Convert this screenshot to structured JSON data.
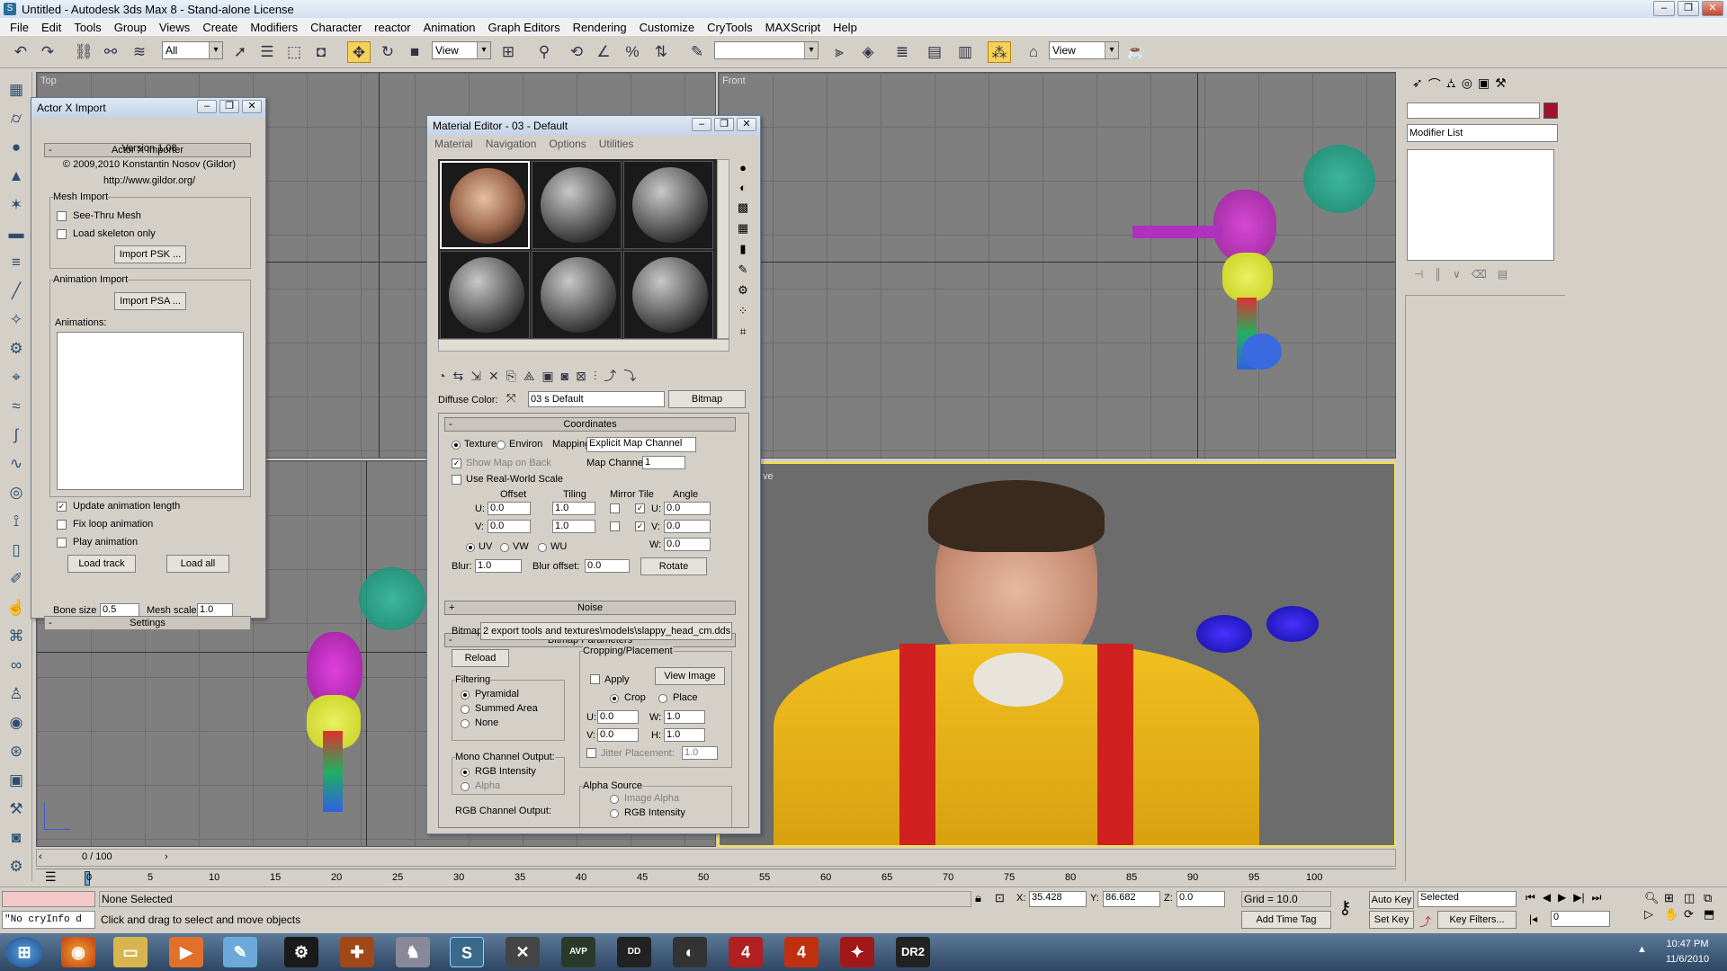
{
  "window": {
    "title": "Untitled - Autodesk 3ds Max 8 - Stand-alone License",
    "icon": "S"
  },
  "menu": [
    "File",
    "Edit",
    "Tools",
    "Group",
    "Views",
    "Create",
    "Modifiers",
    "Character",
    "reactor",
    "Animation",
    "Graph Editors",
    "Rendering",
    "Customize",
    "CryTools",
    "MAXScript",
    "Help"
  ],
  "toolbar": {
    "selection_filter": "All",
    "ref_coord": "View",
    "named_sel": "",
    "render_view": "View"
  },
  "viewports": {
    "top": "Top",
    "front": "Front",
    "persp_fragment": "ve"
  },
  "actorx": {
    "title": "Actor X Import",
    "rollout": "Actor X Importer",
    "version": "Version 1.08",
    "copyright": "© 2009,2010 Konstantin Nosov (Gildor)",
    "url": "http://www.gildor.org/",
    "mesh_import": "Mesh Import",
    "see_thru": "See-Thru Mesh",
    "load_skeleton": "Load skeleton only",
    "import_psk": "Import PSK ...",
    "anim_import": "Animation Import",
    "import_psa": "Import PSA ...",
    "animations": "Animations:",
    "update_len": "Update animation length",
    "fix_loop": "Fix loop animation",
    "play_anim": "Play animation",
    "load_track": "Load track",
    "load_all": "Load all",
    "settings": "Settings",
    "bone_size": "Bone size",
    "bone_size_val": "0.5",
    "mesh_scale": "Mesh scale",
    "mesh_scale_val": "1.0"
  },
  "mated": {
    "title": "Material Editor - 03 - Default",
    "menu": [
      "Material",
      "Navigation",
      "Options",
      "Utilities"
    ],
    "diffuse_label": "Diffuse Color:",
    "material_name": "03 s Default",
    "type_button": "Bitmap",
    "coordinates": "Coordinates",
    "texture": "Texture",
    "environ": "Environ",
    "mapping_label": "Mapping:",
    "mapping_value": "Explicit Map Channel",
    "show_map_back": "Show Map on Back",
    "map_channel_label": "Map Channel:",
    "map_channel_value": "1",
    "real_world": "Use Real-World Scale",
    "offset": "Offset",
    "tiling": "Tiling",
    "mirror_tile": "Mirror Tile",
    "angle": "Angle",
    "u": "U:",
    "v": "V:",
    "w": "W:",
    "offset_u": "0.0",
    "offset_v": "0.0",
    "tiling_u": "1.0",
    "tiling_v": "1.0",
    "angle_u": "0.0",
    "angle_v": "0.0",
    "angle_w": "0.0",
    "uv": "UV",
    "vw": "VW",
    "wu": "WU",
    "blur_label": "Blur:",
    "blur_value": "1.0",
    "blur_offset_label": "Blur offset:",
    "blur_offset_value": "0.0",
    "rotate": "Rotate",
    "noise": "Noise",
    "bitmap_params": "Bitmap Parameters",
    "bitmap_label": "Bitmap:",
    "bitmap_path": "2 export tools and textures\\models\\slappy_head_cm.dds",
    "reload": "Reload",
    "cropping": "Cropping/Placement",
    "apply": "Apply",
    "view_image": "View Image",
    "crop": "Crop",
    "place": "Place",
    "crop_u": "0.0",
    "crop_v": "0.0",
    "crop_w": "1.0",
    "crop_h": "1.0",
    "h": "H:",
    "jitter": "Jitter Placement:",
    "jitter_val": "1.0",
    "filtering": "Filtering",
    "pyramidal": "Pyramidal",
    "summed": "Summed Area",
    "none": "None",
    "mono": "Mono Channel Output:",
    "rgb_intensity": "RGB Intensity",
    "alpha": "Alpha",
    "alpha_source": "Alpha Source",
    "image_alpha": "Image Alpha",
    "rgb_channel": "RGB Channel Output:"
  },
  "cmdpanel": {
    "modifier_list": "Modifier List",
    "name": ""
  },
  "timeline": {
    "frame": "0 / 100",
    "ticks": [
      "0",
      "5",
      "10",
      "15",
      "20",
      "25",
      "30",
      "35",
      "40",
      "45",
      "50",
      "55",
      "60",
      "65",
      "70",
      "75",
      "80",
      "85",
      "90",
      "95",
      "100"
    ]
  },
  "status": {
    "listener": "\"No cryInfo d",
    "selection": "None Selected",
    "prompt": "Click and drag to select and move objects",
    "x_label": "X:",
    "x": "35.428",
    "y_label": "Y:",
    "y": "86.682",
    "z_label": "Z:",
    "z": "0.0",
    "grid": "Grid = 10.0",
    "add_time_tag": "Add Time Tag",
    "auto_key": "Auto Key",
    "set_key": "Set Key",
    "key_mode": "Selected",
    "key_filters": "Key Filters...",
    "current_frame": "0"
  },
  "clock": {
    "time": "10:47 PM",
    "date": "11/6/2010"
  },
  "colors": {
    "accent": "#f6d25a",
    "active_viewport": "#f2e14a",
    "swatch": "#a01030"
  }
}
